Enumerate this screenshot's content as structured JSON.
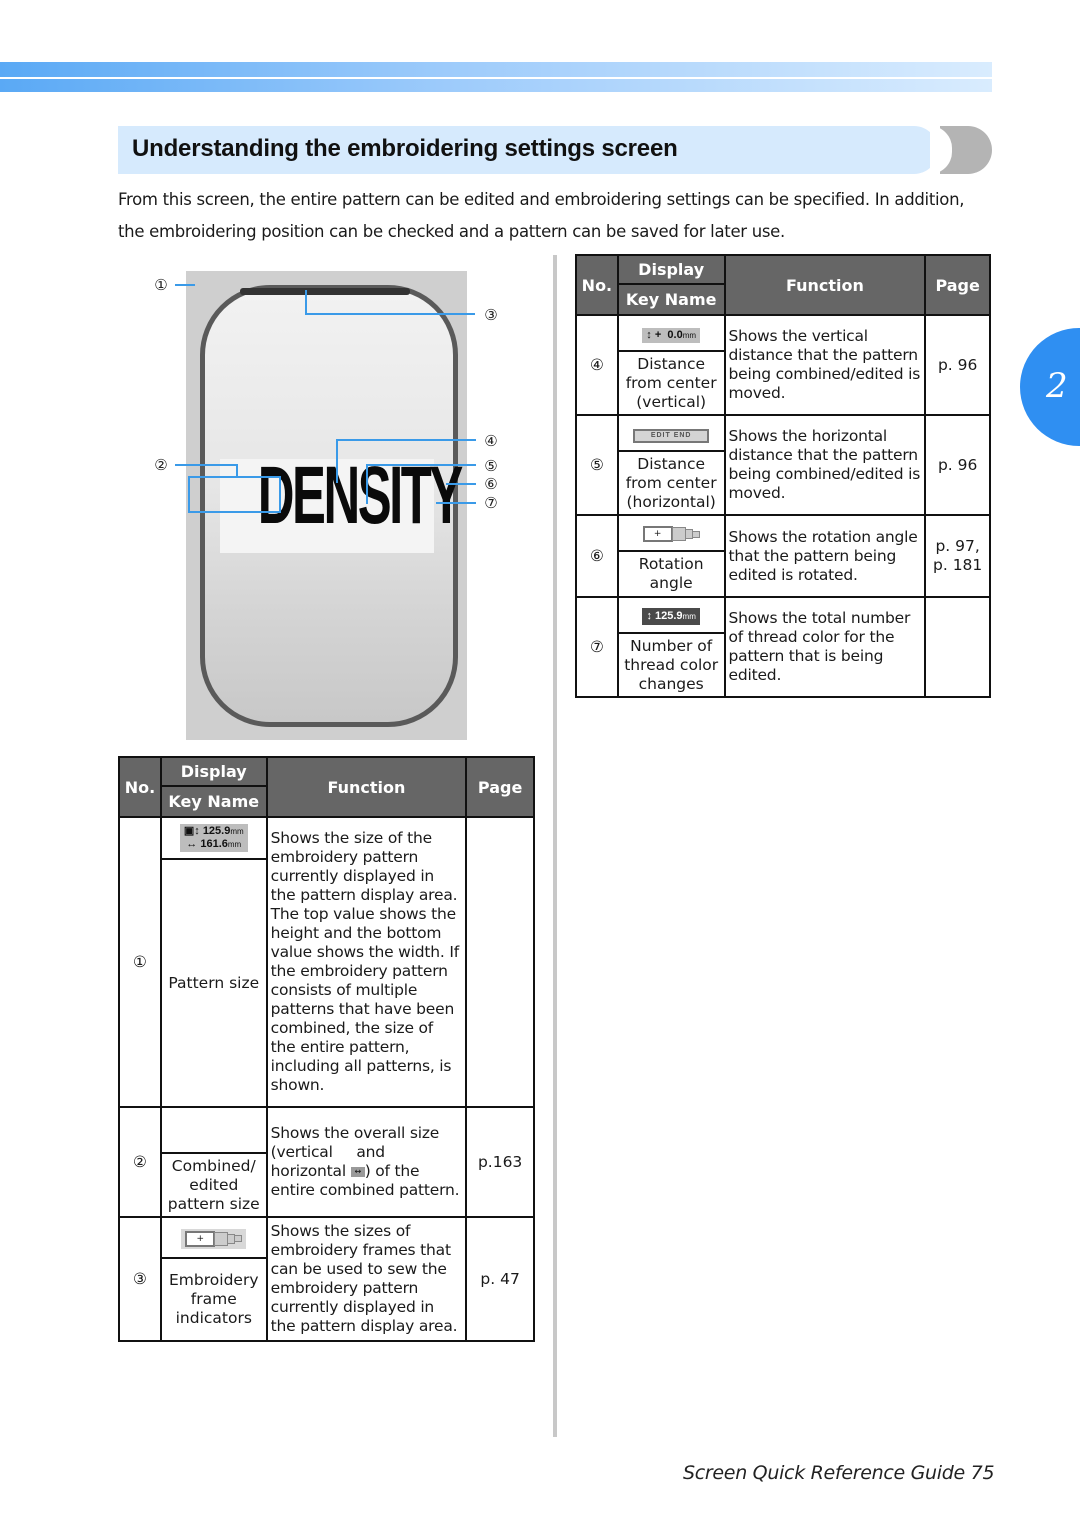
{
  "header": {
    "title": "Understanding the embroidering settings screen",
    "intro_line1": "From this screen, the entire pattern can be edited and embroidering settings can be specified. In addition,",
    "intro_line2": "the embroidering position can be checked and a pattern can be saved for later use."
  },
  "figure": {
    "pattern_text": "DENSITY",
    "callouts": [
      "①",
      "②",
      "③",
      "④",
      "⑤",
      "⑥",
      "⑦"
    ]
  },
  "table_headers": {
    "no": "No.",
    "display": "Display",
    "key_name": "Key Name",
    "function": "Function",
    "page": "Page"
  },
  "left_table": {
    "rows": [
      {
        "no": "①",
        "display": {
          "height": "125.9",
          "width": "161.6",
          "unit": "mm"
        },
        "key_name": "Pattern size",
        "function": "Shows the size of the embroidery pattern currently displayed in the pattern display area. The top value shows the height and the bottom value shows the width. If the embroidery pattern consists of multiple patterns that have been combined, the size of the entire pattern, including all patterns, is shown.",
        "page": ""
      },
      {
        "no": "②",
        "display": "",
        "key_name": "Combined/ edited pattern size",
        "function_part1": "Shows the overall size (vertical",
        "function_part2": "and",
        "function_part3": "horizontal",
        "function_part4": ") of the entire combined pattern.",
        "page": "p.163"
      },
      {
        "no": "③",
        "display": "frame-indicator",
        "key_name": "Embroidery frame indicators",
        "function": "Shows the sizes of embroidery frames that can be used to sew the embroidery pattern currently displayed in the pattern display area.",
        "page": "p. 47"
      }
    ]
  },
  "right_table": {
    "rows": [
      {
        "no": "④",
        "display": {
          "value": "0.0",
          "unit": "mm"
        },
        "key_name": "Distance from center (vertical)",
        "function": "Shows the vertical distance that the pattern being combined/edited is moved.",
        "page": "p. 96"
      },
      {
        "no": "⑤",
        "display": {
          "label": "EDIT END"
        },
        "key_name": "Distance from center (horizontal)",
        "function": "Shows the horizontal distance that the pattern being combined/edited is moved.",
        "page": "p. 96"
      },
      {
        "no": "⑥",
        "display": "frame-indicator",
        "key_name": "Rotation angle",
        "function": "Shows the rotation angle that the pattern being edited is rotated.",
        "page": "p. 97, p. 181"
      },
      {
        "no": "⑦",
        "display": {
          "value": "125.9",
          "unit": "mm"
        },
        "key_name": "Number of thread color changes",
        "function": "Shows the total number of thread color for the pattern that is being edited.",
        "page": ""
      }
    ]
  },
  "chapter_tab": "2",
  "footer": "Screen Quick Reference Guide 75",
  "colors": {
    "accent_blue": "#2f8ff2",
    "title_bg": "#d6eafd",
    "header_gray": "#666666",
    "callout_line": "#3a9ae8"
  }
}
